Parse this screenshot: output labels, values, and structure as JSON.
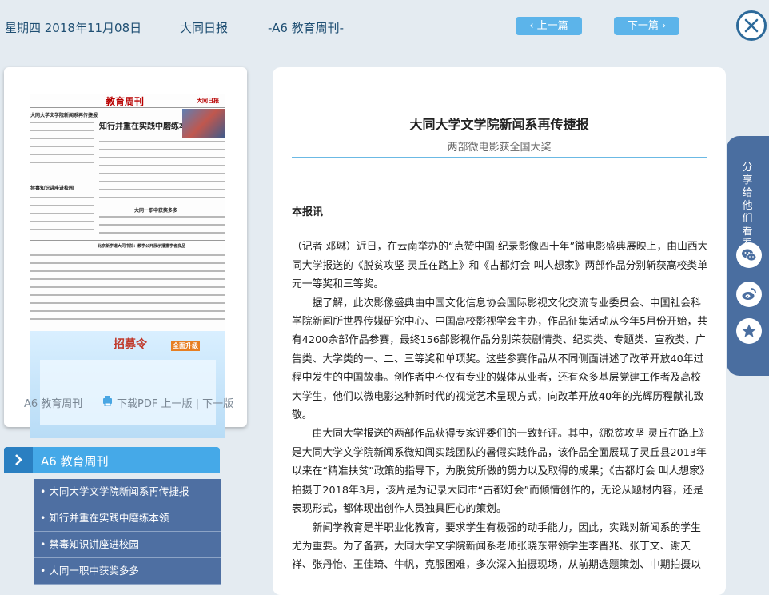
{
  "header": {
    "date": "星期四 2018年11月08日",
    "paper": "大同日报",
    "section": "-A6 教育周刊-",
    "prev_label": "上一篇",
    "next_label": "下一篇"
  },
  "thumbnail": {
    "page_name": "教育周刊",
    "paper_name": "大同日报",
    "headlines": [
      "大同大学文学院新闻系再传捷报",
      "知行并重在实践中磨练本领",
      "禁毒知识讲座进校园",
      "北京新学道大同书院：教学公开展示播撒学者良品",
      "大同一职中获奖多多",
      "招募令",
      "全面升级"
    ],
    "caption": "A6 教育周刊",
    "pdf_label": "下载PDF",
    "prev_page": "上一版",
    "next_page": "下一版",
    "separator": "|"
  },
  "section_nav": {
    "title": "A6  教育周刊",
    "items": [
      "• 大同大学文学院新闻系再传捷报",
      "• 知行并重在实践中磨练本领",
      "• 禁毒知识讲座进校园",
      "• 大同一职中获奖多多"
    ]
  },
  "article": {
    "title": "大同大学文学院新闻系再传捷报",
    "subtitle": "两部微电影获全国大奖",
    "lead": "本报讯",
    "paragraphs": [
      "（记者 邓琳）近日，在云南举办的“点赞中国·纪录影像四十年”微电影盛典展映上，由山西大同大学报送的《脱贫攻坚 灵丘在路上》和《古都灯会 叫人想家》两部作品分别斩获高校类单元一等奖和三等奖。",
      "据了解，此次影像盛典由中国文化信息协会国际影视文化交流专业委员会、中国社会科学院新闻所世界传媒研究中心、中国高校影视学会主办，作品征集活动从今年5月份开始，共有4200余部作品参赛，最终156部影视作品分别荣获剧情类、纪实类、专题类、宣教类、广告类、大学类的一、二、三等奖和单项奖。这些参赛作品从不同侧面讲述了改革开放40年过程中发生的中国故事。创作者中不仅有专业的媒体从业者，还有众多基层党建工作者及高校大学生，他们以微电影这种新时代的视觉艺术呈现方式，向改革开放40年的光辉历程献礼致敬。",
      "由大同大学报送的两部作品获得专家评委们的一致好评。其中，《脱贫攻坚 灵丘在路上》是大同大学文学院新闻系微知闻实践团队的暑假实践作品，该作品全面展现了灵丘县2013年以来在“精准扶贫”政策的指导下，为脱贫所做的努力以及取得的成果；《古都灯会 叫人想家》拍摄于2018年3月，该片是为记录大同市“古都灯会”而倾情创作的，无论从题材内容，还是表现形式，都体现出创作人员独具匠心的策划。",
      "新闻学教育是半职业化教育，要求学生有极强的动手能力，因此，实践对新闻系的学生尤为重要。为了备赛，大同大学文学院新闻系老师张晓东带领学生李晋兆、张丁文、谢天祥、张丹怡、王佳琦、牛帆，克服困难，多次深入拍摄现场，从前期选题策划、中期拍摄以"
    ]
  },
  "share": {
    "label": "分享给他们看看",
    "icons": [
      "wechat-icon",
      "weibo-icon",
      "favorite-icon"
    ]
  },
  "colors": {
    "accent": "#5cb4ea",
    "nav_dark": "#4e6fa2",
    "background": "#e4ebf1"
  }
}
